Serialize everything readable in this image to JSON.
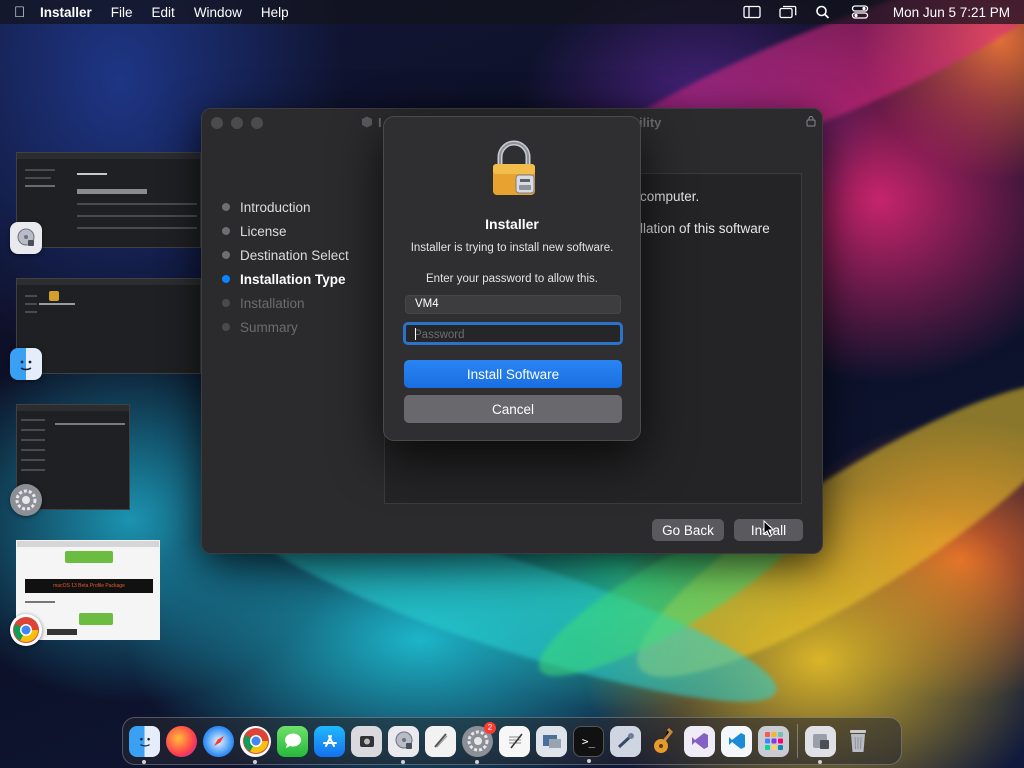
{
  "menubar": {
    "app_name": "Installer",
    "menus": [
      "File",
      "Edit",
      "Window",
      "Help"
    ],
    "clock": "Mon Jun 5  7:21 PM",
    "status_icons": [
      "sidebar-icon",
      "window-stack-icon",
      "search-icon",
      "control-center-icon"
    ]
  },
  "installer_window": {
    "title_left": "I",
    "title_right": "ility",
    "steps": [
      {
        "label": "Introduction",
        "state": "done"
      },
      {
        "label": "License",
        "state": "done"
      },
      {
        "label": "Destination Select",
        "state": "done"
      },
      {
        "label": "Installation Type",
        "state": "current"
      },
      {
        "label": "Installation",
        "state": "future"
      },
      {
        "label": "Summary",
        "state": "future"
      }
    ],
    "content_line1": "computer.",
    "content_line2": "llation of this software",
    "go_back_label": "Go Back",
    "install_label": "Install"
  },
  "auth_dialog": {
    "heading": "Installer",
    "message": "Installer is trying to install new software.",
    "prompt": "Enter your password to allow this.",
    "username_value": "VM4",
    "password_placeholder": "Password",
    "install_button_label": "Install Software",
    "cancel_button_label": "Cancel"
  },
  "mission_control": {
    "thumb4_banner": "macOS 13 Beta Profile Package"
  },
  "dock": {
    "apps": [
      "Finder",
      "Firefox",
      "Safari",
      "Chrome",
      "Messages",
      "App Store",
      "Screenshot",
      "Disk Utility",
      "Script Editor",
      "System Settings",
      "TextEdit",
      "Preview",
      "Terminal",
      "Xcode Tools",
      "GarageBand",
      "Visual Studio",
      "VS Code",
      "Launchpad"
    ],
    "system_settings_badge": "2"
  },
  "colors": {
    "accent": "#0a84ff",
    "primary_button": "#1a6fe0",
    "window_bg": "#2b2b2d"
  }
}
